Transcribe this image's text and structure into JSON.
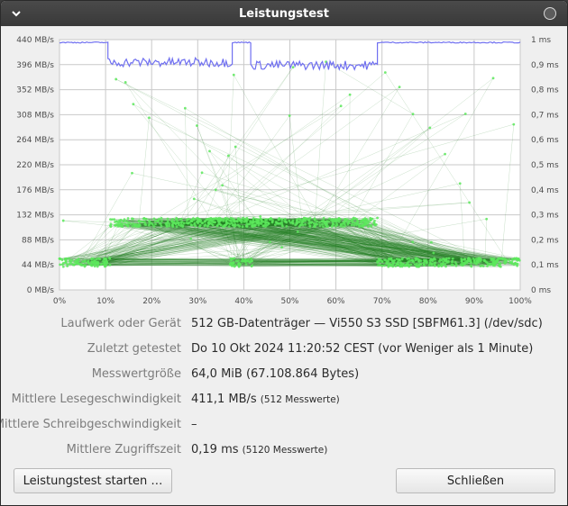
{
  "window": {
    "title": "Leistungstest"
  },
  "chart_data": {
    "type": "scatter",
    "x_ticks": [
      "0%",
      "10%",
      "20%",
      "30%",
      "40%",
      "50%",
      "60%",
      "70%",
      "80%",
      "90%",
      "100%"
    ],
    "y_left_ticks": [
      "0 MB/s",
      "44 MB/s",
      "88 MB/s",
      "132 MB/s",
      "176 MB/s",
      "220 MB/s",
      "264 MB/s",
      "308 MB/s",
      "352 MB/s",
      "396 MB/s",
      "440 MB/s"
    ],
    "y_right_ticks": [
      "0 ms",
      "0,1 ms",
      "0,2 ms",
      "0,3 ms",
      "0,4 ms",
      "0,5 ms",
      "0,6 ms",
      "0,7 ms",
      "0,8 ms",
      "0,9 ms",
      "1 ms"
    ],
    "xlim": [
      0,
      100
    ],
    "ylim_left": [
      0,
      440
    ],
    "ylim_right": [
      0,
      1
    ],
    "grid": true,
    "colors": {
      "read": "#6f6ff0",
      "access": "#5ce85c",
      "access_lines": "#1e7a1e"
    },
    "read_rate_segments": [
      {
        "x": [
          0,
          10.5
        ],
        "mbps": 435
      },
      {
        "x": [
          10.5,
          37.5
        ],
        "mbps": 400
      },
      {
        "x": [
          37.5,
          41.5
        ],
        "mbps": 435
      },
      {
        "x": [
          41.5,
          69
        ],
        "mbps": 395
      },
      {
        "x": [
          69,
          100
        ],
        "mbps": 435
      }
    ],
    "access_time_clusters": [
      {
        "x": [
          0,
          11
        ],
        "ms": 0.11
      },
      {
        "x": [
          11,
          42
        ],
        "ms": 0.27
      },
      {
        "x": [
          37,
          42
        ],
        "ms": 0.11
      },
      {
        "x": [
          42,
          69
        ],
        "ms": 0.27
      },
      {
        "x": [
          69,
          100
        ],
        "ms": 0.11
      }
    ]
  },
  "info": [
    {
      "label": "Laufwerk oder Gerät",
      "value": "512 GB-Datenträger — Vi550 S3 SSD [SBFM61.3] (/dev/sdc)",
      "note": ""
    },
    {
      "label": "Zuletzt getestet",
      "value": "Do 10 Okt 2024 11:20:52 CEST (vor Weniger als 1 Minute)",
      "note": ""
    },
    {
      "label": "Messwertgröße",
      "value": "64,0 MiB (67.108.864 Bytes)",
      "note": ""
    },
    {
      "label": "Mittlere Lesegeschwindigkeit",
      "value": "411,1 MB/s",
      "note": "(512 Messwerte)"
    },
    {
      "label": "Mittlere Schreibgeschwindigkeit",
      "value": "–",
      "note": ""
    },
    {
      "label": "Mittlere Zugriffszeit",
      "value": "0,19 ms",
      "note": "(5120 Messwerte)"
    }
  ],
  "buttons": {
    "start": "Leistungstest starten …",
    "close": "Schließen"
  },
  "icons": {
    "menu": "chevron-down-icon",
    "close": "close-circle-icon"
  }
}
